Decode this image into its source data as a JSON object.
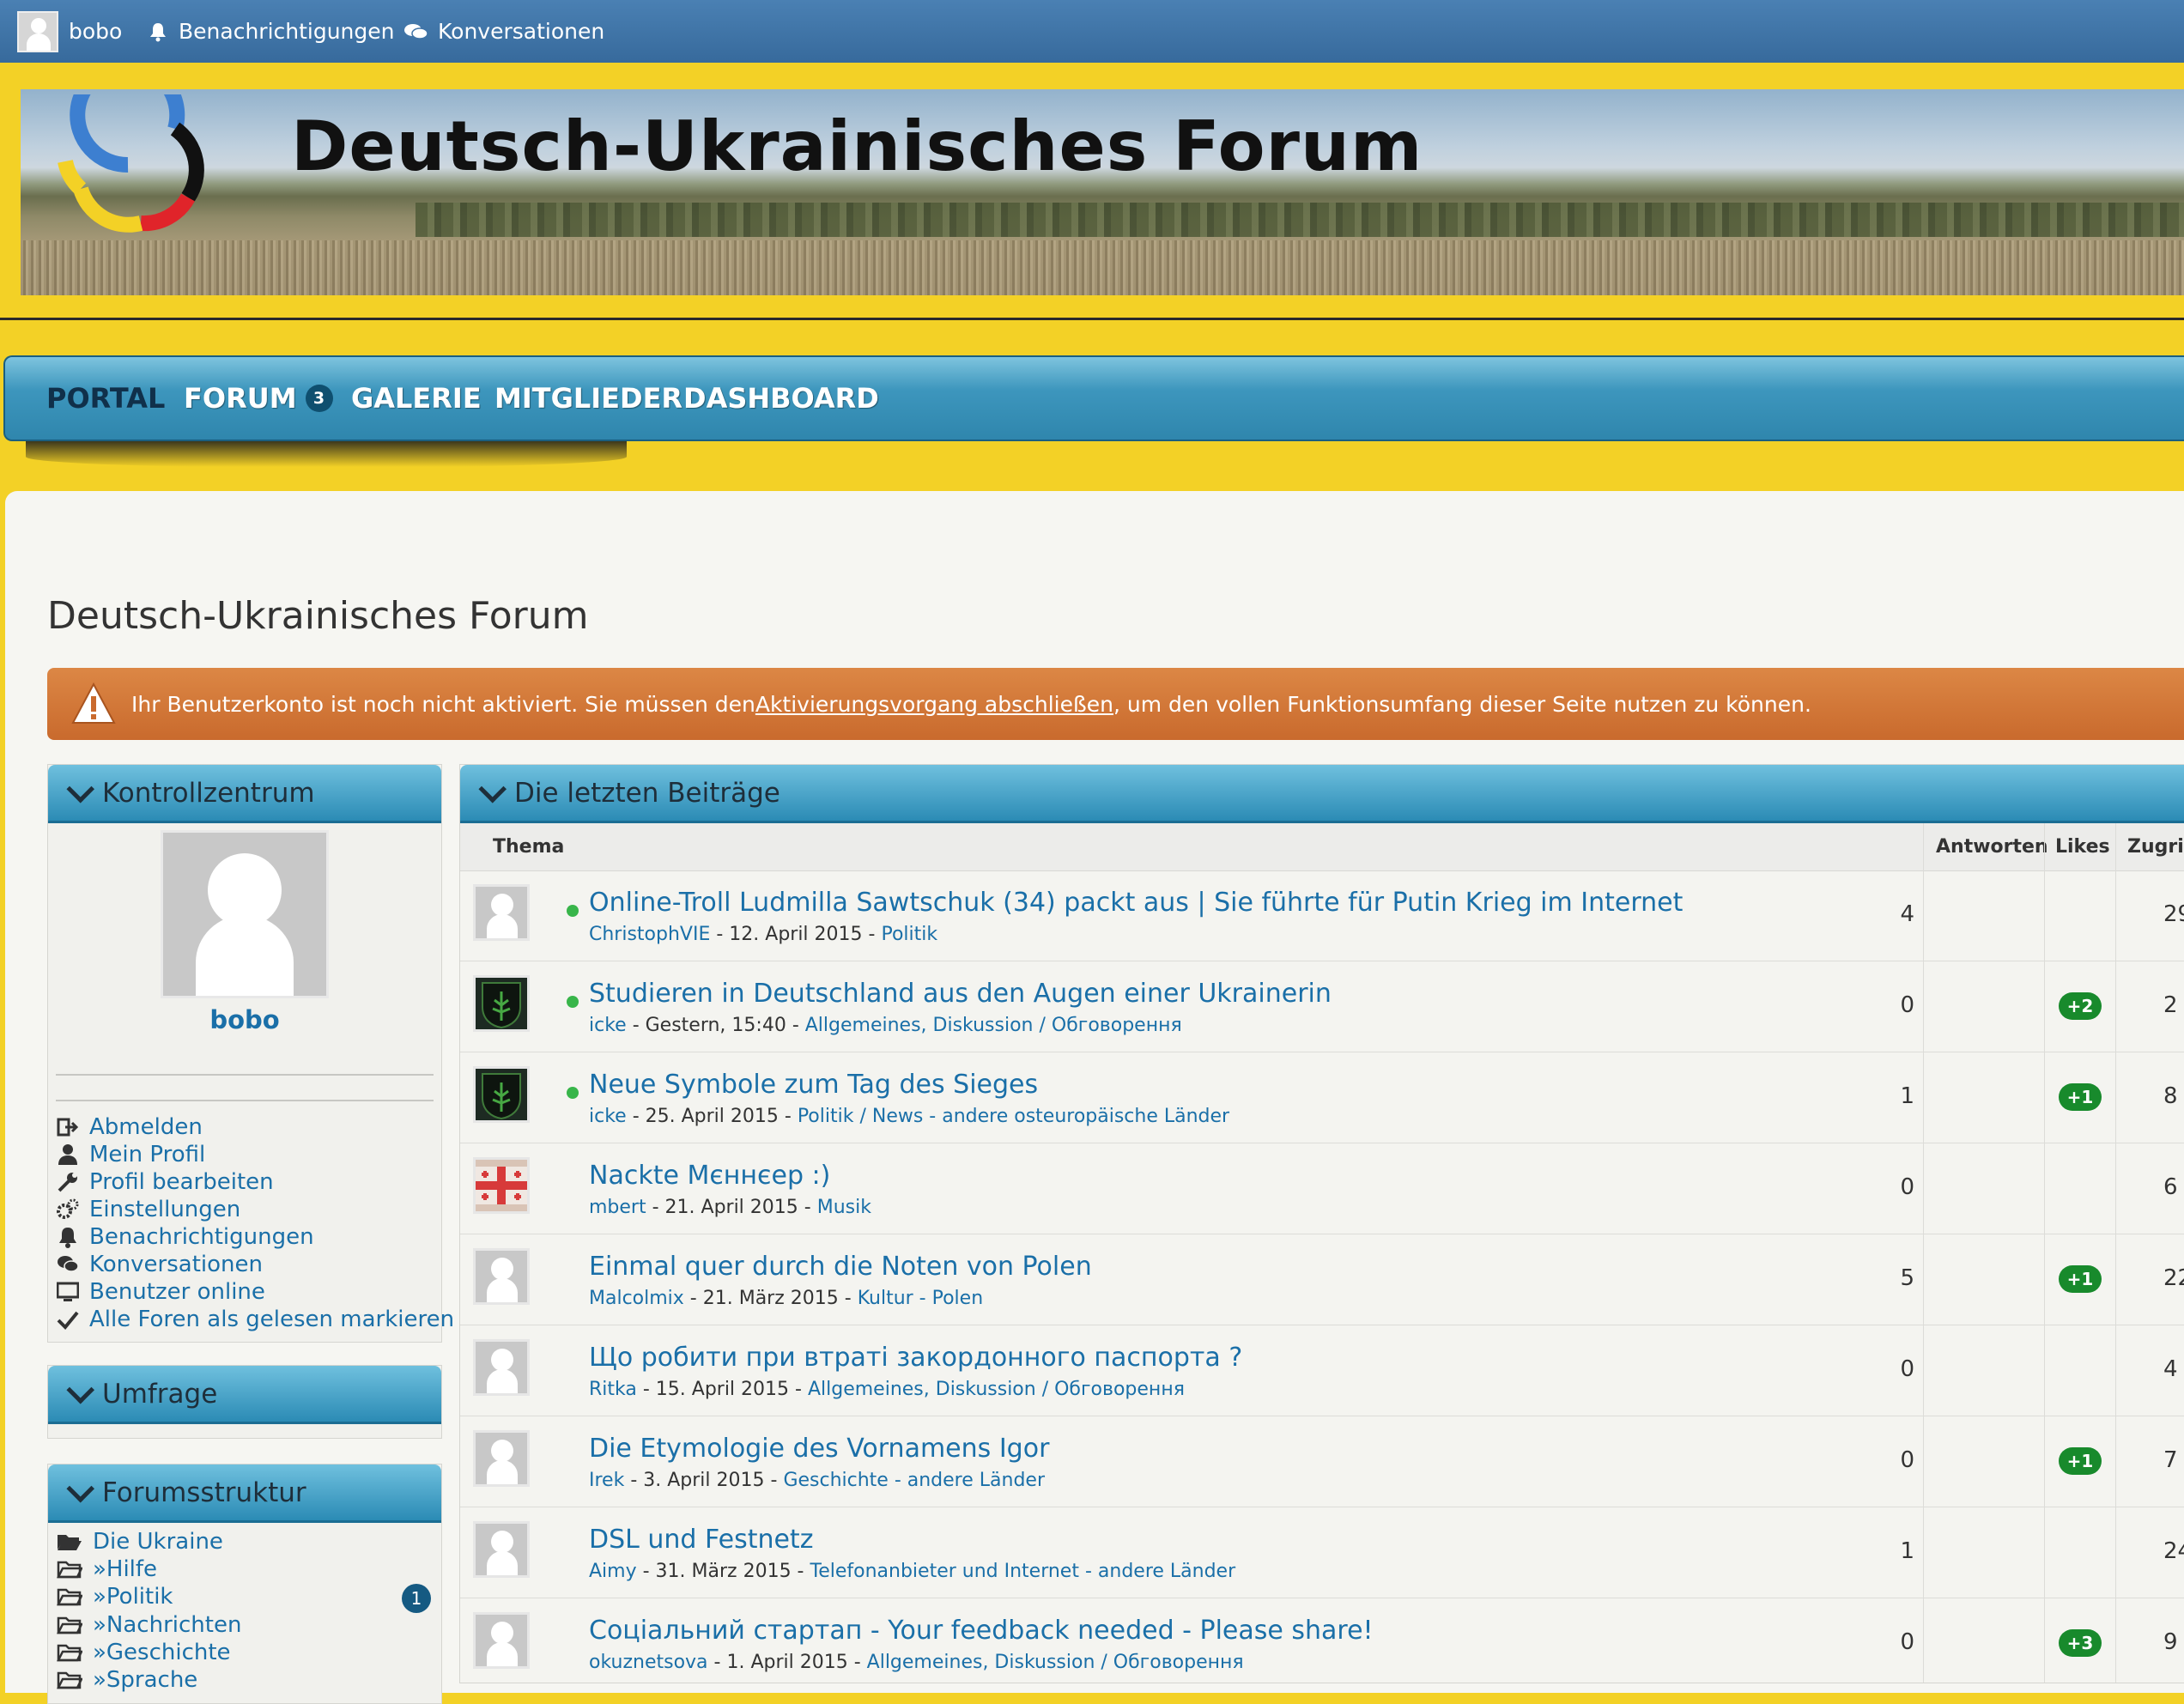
{
  "userbar": {
    "username": "bobo",
    "notifications": "Benachrichtigungen",
    "conversations": "Konversationen"
  },
  "banner": {
    "title": "Deutsch-Ukrainisches Forum"
  },
  "nav": {
    "tabs": [
      {
        "label": "PORTAL",
        "active": true
      },
      {
        "label": "FORUM",
        "badge": "3"
      },
      {
        "label": "GALERIE"
      },
      {
        "label": "MITGLIEDER"
      },
      {
        "label": "DASHBOARD"
      }
    ]
  },
  "page": {
    "title": "Deutsch-Ukrainisches Forum"
  },
  "notice": {
    "before": "Ihr Benutzerkonto ist noch nicht aktiviert. Sie müssen den ",
    "link": "Aktivierungsvorgang abschließen",
    "after": ", um den vollen Funktionsumfang dieser Seite nutzen zu können."
  },
  "sidebar": {
    "control": {
      "title": "Kontrollzentrum",
      "username": "bobo",
      "items": [
        {
          "label": "Abmelden",
          "icon": "sign-out-icon"
        },
        {
          "label": "Mein Profil",
          "icon": "user-icon"
        },
        {
          "label": "Profil bearbeiten",
          "icon": "wrench-icon"
        },
        {
          "label": "Einstellungen",
          "icon": "gears-icon"
        },
        {
          "label": "Benachrichtigungen",
          "icon": "bell-icon"
        },
        {
          "label": "Konversationen",
          "icon": "comments-icon"
        },
        {
          "label": "Benutzer online",
          "icon": "monitor-icon"
        },
        {
          "label": "Alle Foren als gelesen markieren",
          "icon": "check-icon"
        }
      ]
    },
    "poll": {
      "title": "Umfrage"
    },
    "structure": {
      "title": "Forumsstruktur",
      "items": [
        {
          "label": "Die Ukraine",
          "icon": "folder-open-icon"
        },
        {
          "label": "»Hilfe",
          "icon": "folder-icon"
        },
        {
          "label": "»Politik",
          "icon": "folder-icon",
          "badge": "1"
        },
        {
          "label": "»Nachrichten",
          "icon": "folder-icon"
        },
        {
          "label": "»Geschichte",
          "icon": "folder-icon"
        },
        {
          "label": "»Sprache",
          "icon": "folder-icon"
        }
      ]
    }
  },
  "threads": {
    "title": "Die letzten Beiträge",
    "columns": {
      "topic": "Thema",
      "replies": "Antworten",
      "likes": "Likes",
      "views": "Zugriffe"
    },
    "rows": [
      {
        "title": "Online-Troll Ludmilla Sawtschuk (34) packt aus | Sie führte für Putin Krieg im Internet",
        "author": "ChristophVIE",
        "date": " - 12. April 2015 - ",
        "category": "Politik",
        "replies": "4",
        "likes": "",
        "views": "29",
        "new": true,
        "avatar": "default"
      },
      {
        "title": "Studieren in Deutschland aus den Augen einer Ukrainerin",
        "author": "icke",
        "date": " - Gestern, 15:40 - ",
        "category": "Allgemeines, Diskussion / Обговорення",
        "replies": "0",
        "likes": "+2",
        "views": "2",
        "new": true,
        "avatar": "dark"
      },
      {
        "title": "Neue Symbole zum Tag des Sieges",
        "author": "icke",
        "date": " - 25. April 2015 - ",
        "category": "Politik / News - andere osteuropäische Länder",
        "replies": "1",
        "likes": "+1",
        "views": "8",
        "new": true,
        "avatar": "dark"
      },
      {
        "title": "Nackte Мєннєер :)",
        "author": "mbert",
        "date": " - 21. April 2015 - ",
        "category": "Musik",
        "replies": "0",
        "likes": "",
        "views": "6",
        "new": false,
        "avatar": "flag"
      },
      {
        "title": "Einmal quer durch die Noten von Polen",
        "author": "Malcolmix",
        "date": " - 21. März 2015 - ",
        "category": "Kultur - Polen",
        "replies": "5",
        "likes": "+1",
        "views": "22",
        "new": false,
        "avatar": "default"
      },
      {
        "title": "Що робити при втраті закордонного паспорта ?",
        "author": "Ritka",
        "date": " - 15. April 2015 - ",
        "category": "Allgemeines, Diskussion / Обговорення",
        "replies": "0",
        "likes": "",
        "views": "4",
        "new": false,
        "avatar": "default"
      },
      {
        "title": "Die Etymologie des Vornamens Igor",
        "author": "Irek",
        "date": " - 3. April 2015 - ",
        "category": "Geschichte - andere Länder",
        "replies": "0",
        "likes": "+1",
        "views": "7",
        "new": false,
        "avatar": "default"
      },
      {
        "title": "DSL und Festnetz",
        "author": "Aimy",
        "date": " - 31. März 2015 - ",
        "category": "Telefonanbieter und Internet - andere Länder",
        "replies": "1",
        "likes": "",
        "views": "24",
        "new": false,
        "avatar": "default"
      },
      {
        "title": "Соціальний стартап - Your feedback needed - Please share!",
        "author": "okuznetsova",
        "date": " - 1. April 2015 - ",
        "category": "Allgemeines, Diskussion / Обговорення",
        "replies": "0",
        "likes": "+3",
        "views": "9",
        "new": false,
        "avatar": "default"
      }
    ]
  },
  "colors": {
    "accent": "#1a6fa8",
    "yellow": "#f3d126",
    "nav": "#2f86ad",
    "like": "#188a2c",
    "new_dot": "#38b54a"
  }
}
